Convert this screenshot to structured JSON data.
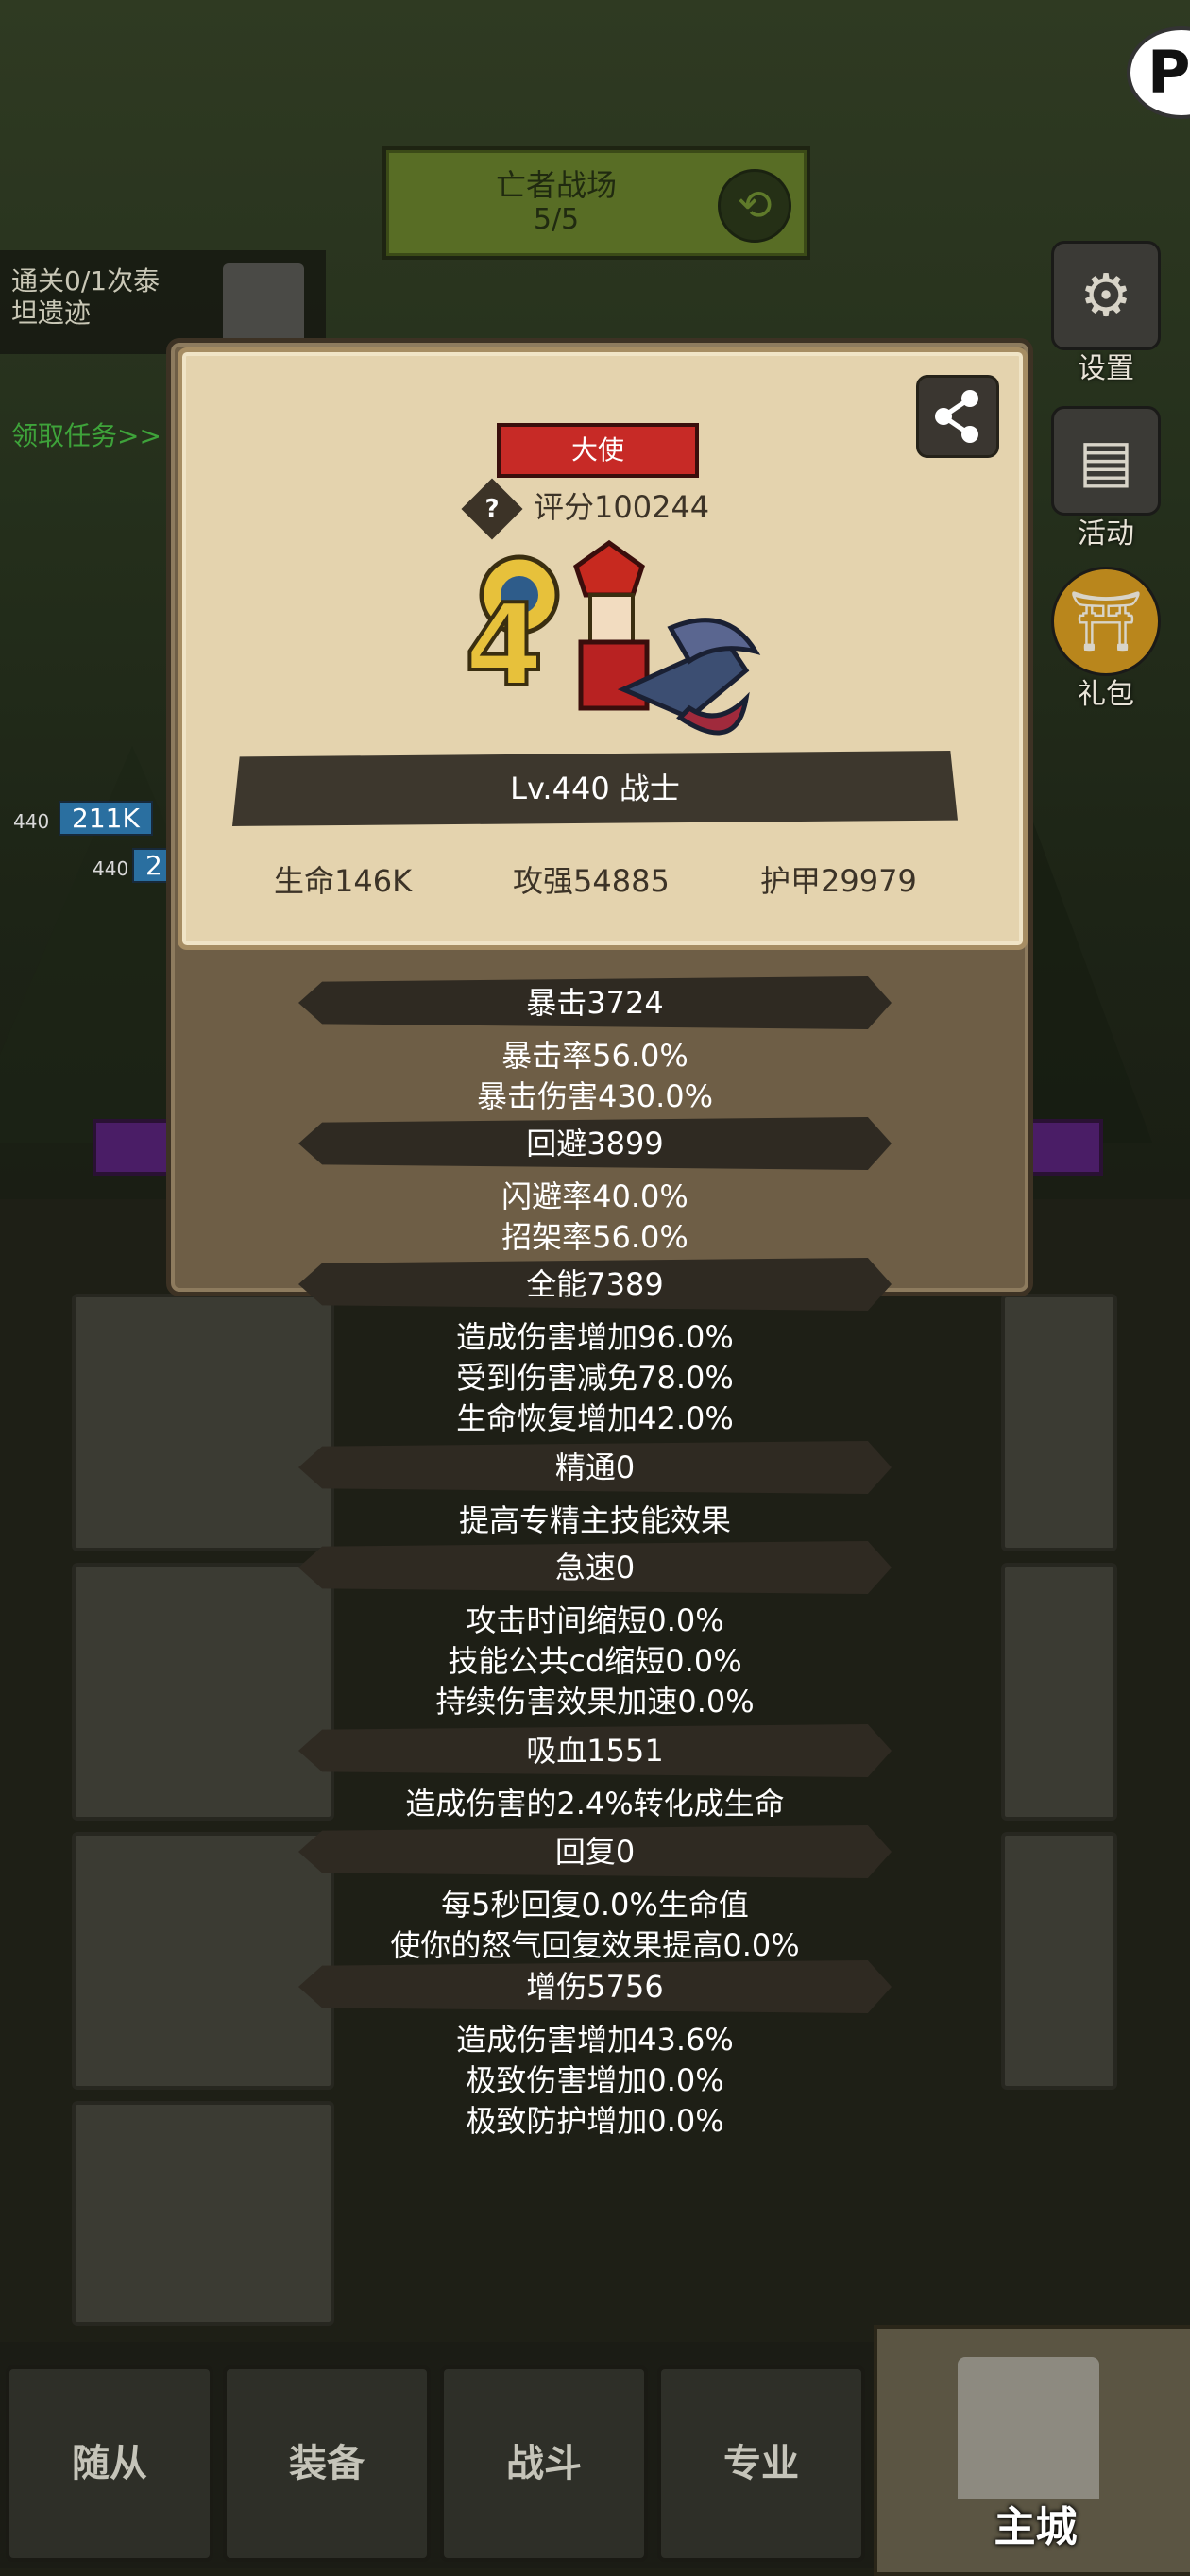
{
  "arena": {
    "title": "亡者战场",
    "progress": "5/5",
    "swap_icon": "swap-icon"
  },
  "quest": {
    "text_line1": "通关0/1次泰",
    "text_line2": "坦遗迹",
    "receive": "领取任务>>"
  },
  "side_menu": [
    {
      "label": "设置",
      "icon": "gear-icon"
    },
    {
      "label": "活动",
      "icon": "scroll-icon"
    },
    {
      "label": "礼包",
      "icon": "gift-icon"
    }
  ],
  "battle": {
    "hp_tag_1": "211K",
    "hp_tag_2": "2",
    "level_1": "440",
    "level_2": "440"
  },
  "popup": {
    "title_badge": "大使",
    "score": "评分100244",
    "level_class": "Lv.440 战士",
    "hp": "生命146K",
    "attack": "攻强54885",
    "armor": "护甲29979",
    "sections": [
      {
        "header": "暴击3724",
        "lines": [
          "暴击率56.0%",
          "暴击伤害430.0%"
        ]
      },
      {
        "header": "回避3899",
        "lines": [
          "闪避率40.0%",
          "招架率56.0%"
        ]
      },
      {
        "header": "全能7389",
        "lines": [
          "造成伤害增加96.0%",
          "受到伤害减免78.0%",
          "生命恢复增加42.0%"
        ]
      },
      {
        "header": "精通0",
        "lines": [
          "提高专精主技能效果"
        ]
      },
      {
        "header": "急速0",
        "lines": [
          "攻击时间缩短0.0%",
          "技能公共cd缩短0.0%",
          "持续伤害效果加速0.0%"
        ]
      },
      {
        "header": "吸血1551",
        "lines": [
          "造成伤害的2.4%转化成生命"
        ]
      },
      {
        "header": "回复0",
        "lines": [
          "每5秒回复0.0%生命值",
          "使你的怒气回复效果提高0.0%"
        ]
      },
      {
        "header": "增伤5756",
        "lines": [
          "造成伤害增加43.6%",
          "极致伤害增加0.0%",
          "极致防护增加0.0%"
        ]
      }
    ]
  },
  "nav": {
    "followers": "随从",
    "equipment": "装备",
    "battle": "战斗",
    "profession": "专业",
    "main_city": "主城"
  },
  "colors": {
    "badge_red": "#c72a26",
    "card_bg": "#e4d3ae",
    "panel_bg": "#6e5e46",
    "section_bar": "#2f2a22"
  }
}
